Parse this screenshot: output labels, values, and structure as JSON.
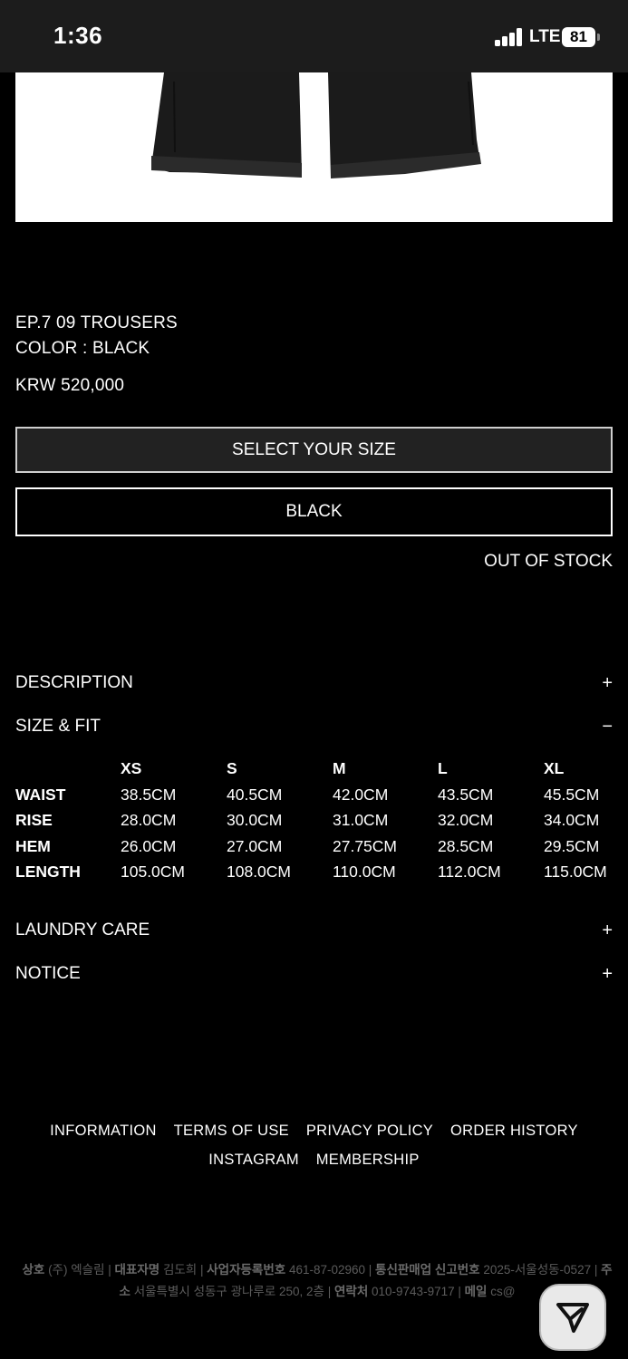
{
  "status_bar": {
    "time": "1:36",
    "network": "LTE",
    "battery": "81"
  },
  "product": {
    "name": "EP.7 09 TROUSERS",
    "color_line": "COLOR : BLACK",
    "price": "KRW 520,000",
    "size_select_label": "SELECT YOUR SIZE",
    "color_option": "BLACK",
    "stock_status": "OUT OF STOCK"
  },
  "accordions": {
    "description": {
      "label": "DESCRIPTION",
      "toggle": "+"
    },
    "size_fit": {
      "label": "SIZE & FIT",
      "toggle": "−"
    },
    "laundry": {
      "label": "LAUNDRY CARE",
      "toggle": "+"
    },
    "notice": {
      "label": "NOTICE",
      "toggle": "+"
    }
  },
  "size_table": {
    "sizes": [
      "XS",
      "S",
      "M",
      "L",
      "XL"
    ],
    "rows": [
      {
        "label": "WAIST",
        "values": [
          "38.5CM",
          "40.5CM",
          "42.0CM",
          "43.5CM",
          "45.5CM"
        ]
      },
      {
        "label": "RISE",
        "values": [
          "28.0CM",
          "30.0CM",
          "31.0CM",
          "32.0CM",
          "34.0CM"
        ]
      },
      {
        "label": "HEM",
        "values": [
          "26.0CM",
          "27.0CM",
          "27.75CM",
          "28.5CM",
          "29.5CM"
        ]
      },
      {
        "label": "LENGTH",
        "values": [
          "105.0CM",
          "108.0CM",
          "110.0CM",
          "112.0CM",
          "115.0CM"
        ]
      }
    ]
  },
  "footer": {
    "links": [
      "INFORMATION",
      "TERMS OF USE",
      "PRIVACY POLICY",
      "ORDER HISTORY",
      "INSTAGRAM",
      "MEMBERSHIP"
    ],
    "company": {
      "name_label": "상호",
      "name": "(주) 엑슬림",
      "ceo_label": "대표자명",
      "ceo": "김도희",
      "biz_no_label": "사업자등록번호",
      "biz_no": "461-87-02960",
      "mail_order_label": "통신판매업 신고번호",
      "mail_order": "2025-서울성동-0527",
      "address_label": "주소",
      "address": "서울특별시 성동구 광나루로 250, 2층",
      "phone_label": "연락처",
      "phone": "010-9743-9717",
      "email_label": "메일",
      "email": "cs@"
    }
  },
  "fab_icon": "send-icon"
}
